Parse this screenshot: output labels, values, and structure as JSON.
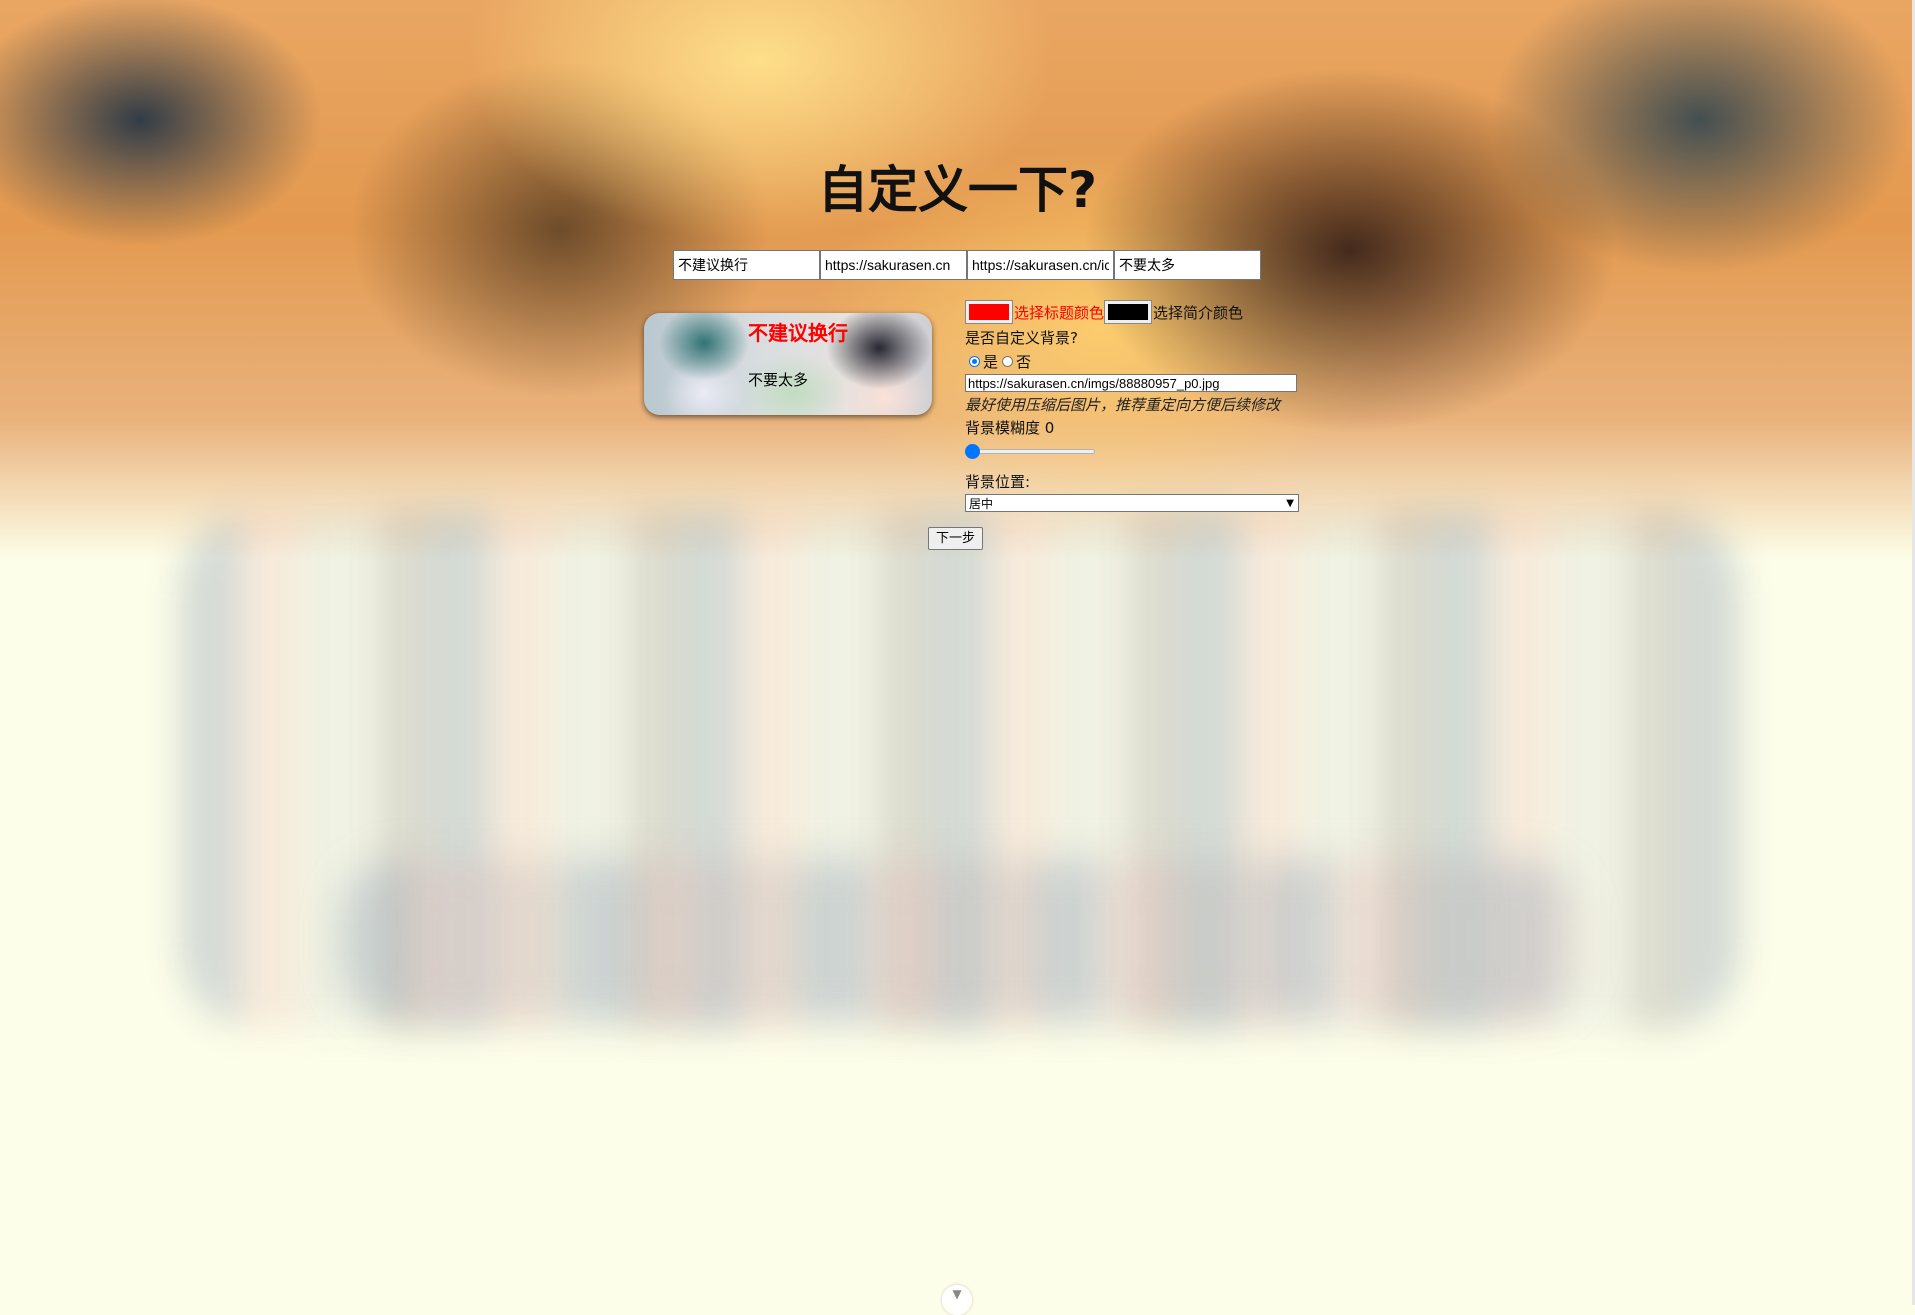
{
  "page": {
    "heading": "自定义一下?"
  },
  "inputs": {
    "title_value": "不建议换行",
    "link_value": "https://sakurasen.cn",
    "icon_url_value": "https://sakurasen.cn/ic",
    "description_value": "不要太多"
  },
  "preview": {
    "title": "不建议换行",
    "description": "不要太多",
    "title_color": "#ff0000",
    "description_color": "#000000"
  },
  "settings": {
    "title_color_value": "#ff0000",
    "title_color_label": "选择标题颜色",
    "desc_color_value": "#000000",
    "desc_color_label": "选择简介颜色",
    "custom_bg_question": "是否自定义背景?",
    "radio_yes": "是",
    "radio_no": "否",
    "custom_bg_selected": "是",
    "bg_url_value": "https://sakurasen.cn/imgs/88880957_p0.jpg",
    "bg_hint": "最好使用压缩后图片，推荐重定向方便后续修改",
    "blur_label": "背景模糊度",
    "blur_value": "0",
    "blur_max": 100,
    "position_label": "背景位置:",
    "position_selected": "居中"
  },
  "actions": {
    "next_label": "下一步",
    "scroll_down_icon": "chevron-down-icon"
  },
  "colors": {
    "accent": "#0075ff",
    "page_background": "#fdfee9"
  }
}
